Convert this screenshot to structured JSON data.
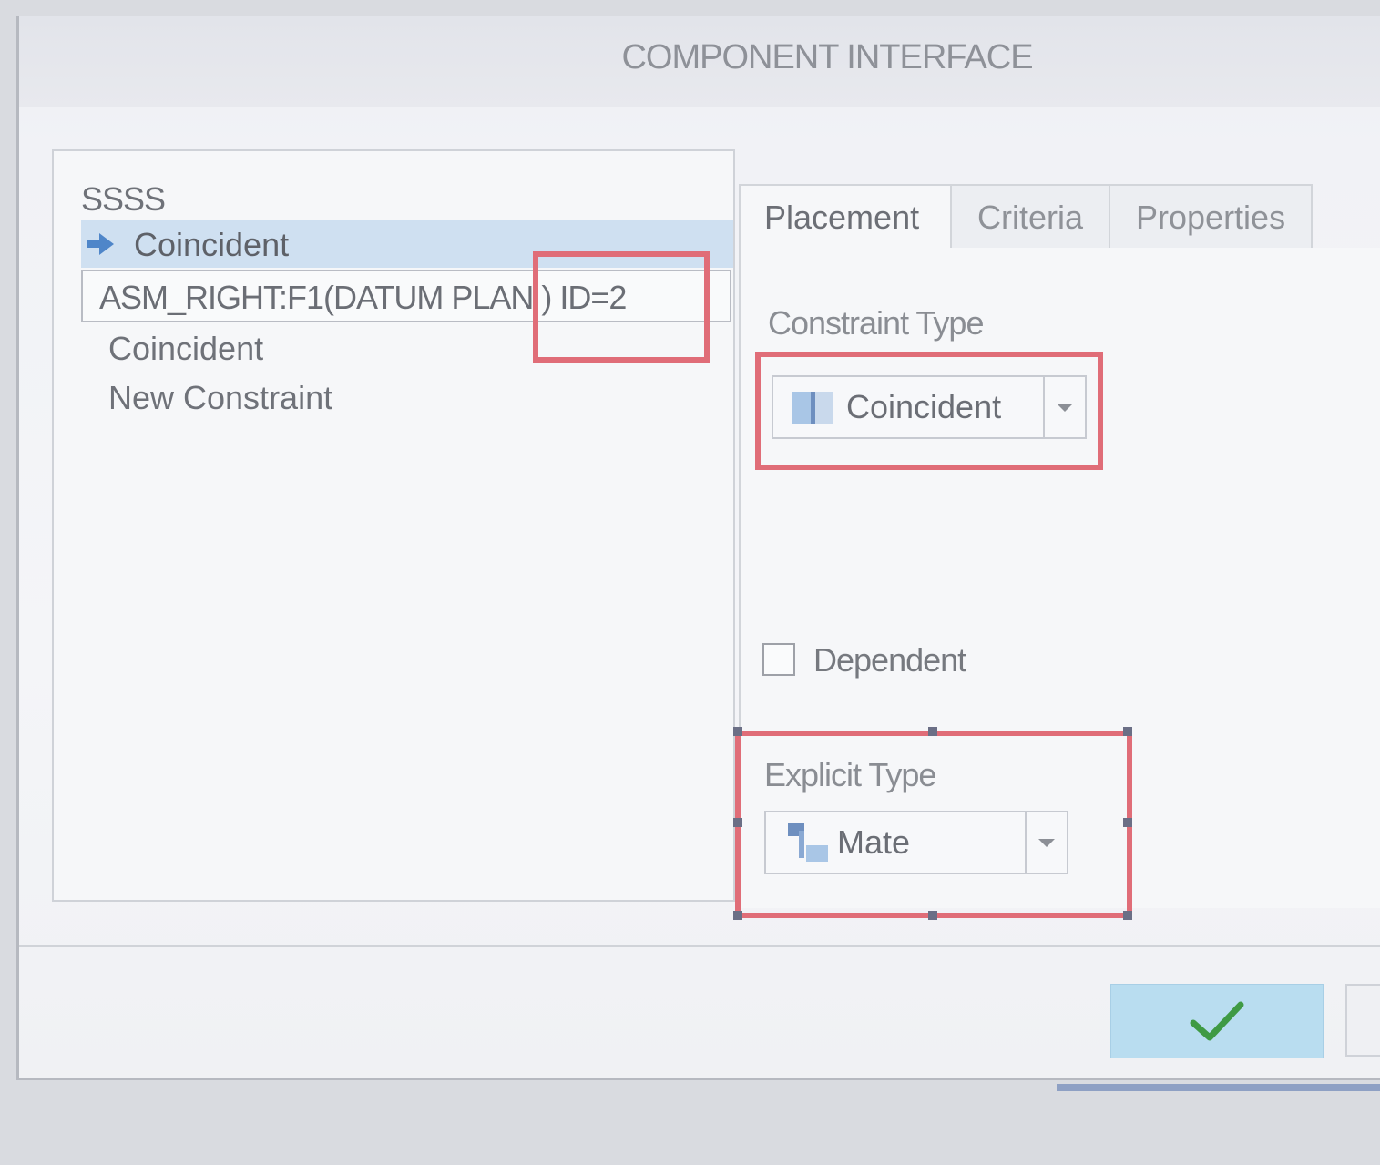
{
  "window": {
    "title": "COMPONENT INTERFACE"
  },
  "tree": {
    "root_label": "SSSS",
    "selected_item_label": "Coincident",
    "reference_field_value": "ASM_RIGHT:F1(DATUM PLAN ) ID=2",
    "children": [
      "Coincident",
      "New Constraint"
    ]
  },
  "tabs": [
    "Placement",
    "Criteria",
    "Properties"
  ],
  "placement": {
    "constraint_type_label": "Constraint Type",
    "constraint_type_value": "Coincident",
    "dependent_label": "Dependent",
    "dependent_checked": false,
    "explicit_type_label": "Explicit Type",
    "explicit_type_value": "Mate"
  },
  "buttons": {
    "ok_icon": "checkmark-icon"
  },
  "colors": {
    "highlight": "#e06d78",
    "selection": "#cfe0f1",
    "ok_button": "#b9ddf0",
    "checkmark": "#3f9a44"
  }
}
